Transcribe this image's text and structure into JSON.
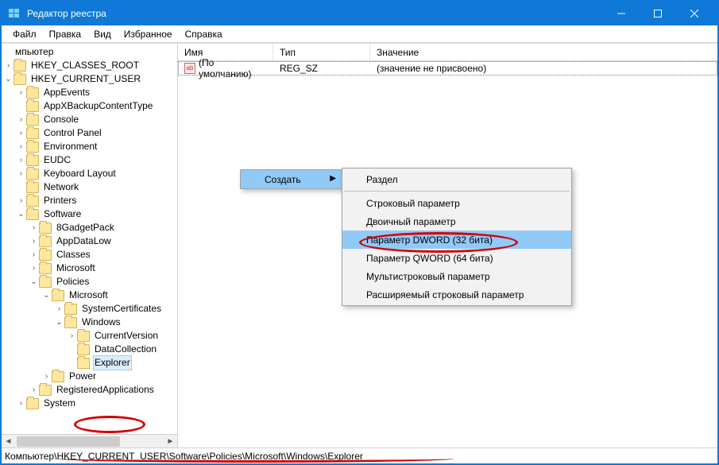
{
  "titlebar": {
    "title": "Редактор реестра"
  },
  "menubar": {
    "items": [
      "Файл",
      "Правка",
      "Вид",
      "Избранное",
      "Справка"
    ]
  },
  "tree": {
    "rows": [
      {
        "indent": 0,
        "exp": "none",
        "label": "мпьютер",
        "no_folder": true
      },
      {
        "indent": 0,
        "exp": "closed",
        "label": "HKEY_CLASSES_ROOT"
      },
      {
        "indent": 0,
        "exp": "open",
        "label": "HKEY_CURRENT_USER"
      },
      {
        "indent": 1,
        "exp": "closed",
        "label": "AppEvents"
      },
      {
        "indent": 1,
        "exp": "none",
        "label": "AppXBackupContentType"
      },
      {
        "indent": 1,
        "exp": "closed",
        "label": "Console"
      },
      {
        "indent": 1,
        "exp": "closed",
        "label": "Control Panel"
      },
      {
        "indent": 1,
        "exp": "closed",
        "label": "Environment"
      },
      {
        "indent": 1,
        "exp": "closed",
        "label": "EUDC"
      },
      {
        "indent": 1,
        "exp": "closed",
        "label": "Keyboard Layout"
      },
      {
        "indent": 1,
        "exp": "none",
        "label": "Network"
      },
      {
        "indent": 1,
        "exp": "closed",
        "label": "Printers"
      },
      {
        "indent": 1,
        "exp": "open",
        "label": "Software"
      },
      {
        "indent": 2,
        "exp": "closed",
        "label": "8GadgetPack"
      },
      {
        "indent": 2,
        "exp": "closed",
        "label": "AppDataLow"
      },
      {
        "indent": 2,
        "exp": "closed",
        "label": "Classes"
      },
      {
        "indent": 2,
        "exp": "closed",
        "label": "Microsoft"
      },
      {
        "indent": 2,
        "exp": "open",
        "label": "Policies"
      },
      {
        "indent": 3,
        "exp": "open",
        "label": "Microsoft"
      },
      {
        "indent": 4,
        "exp": "closed",
        "label": "SystemCertificates"
      },
      {
        "indent": 4,
        "exp": "open",
        "label": "Windows"
      },
      {
        "indent": 5,
        "exp": "closed",
        "label": "CurrentVersion"
      },
      {
        "indent": 5,
        "exp": "none",
        "label": "DataCollection"
      },
      {
        "indent": 5,
        "exp": "none",
        "label": "Explorer",
        "selected": true
      },
      {
        "indent": 3,
        "exp": "closed",
        "label": "Power"
      },
      {
        "indent": 2,
        "exp": "closed",
        "label": "RegisteredApplications"
      },
      {
        "indent": 1,
        "exp": "closed",
        "label": "System"
      }
    ]
  },
  "list": {
    "headers": {
      "name": "Имя",
      "type": "Тип",
      "value": "Значение"
    },
    "rows": [
      {
        "icon": "ab",
        "name": "(По умолчанию)",
        "type": "REG_SZ",
        "value": "(значение не присвоено)",
        "focused": true
      }
    ]
  },
  "context_menu": {
    "primary": {
      "create": "Создать"
    },
    "submenu": {
      "section": "Раздел",
      "string": "Строковый параметр",
      "binary": "Двоичный параметр",
      "dword": "Параметр DWORD (32 бита)",
      "qword": "Параметр QWORD (64 бита)",
      "multistring": "Мультистроковый параметр",
      "expandstring": "Расширяемый строковый параметр"
    }
  },
  "statusbar": {
    "path": "Компьютер\\HKEY_CURRENT_USER\\Software\\Policies\\Microsoft\\Windows\\Explorer"
  }
}
